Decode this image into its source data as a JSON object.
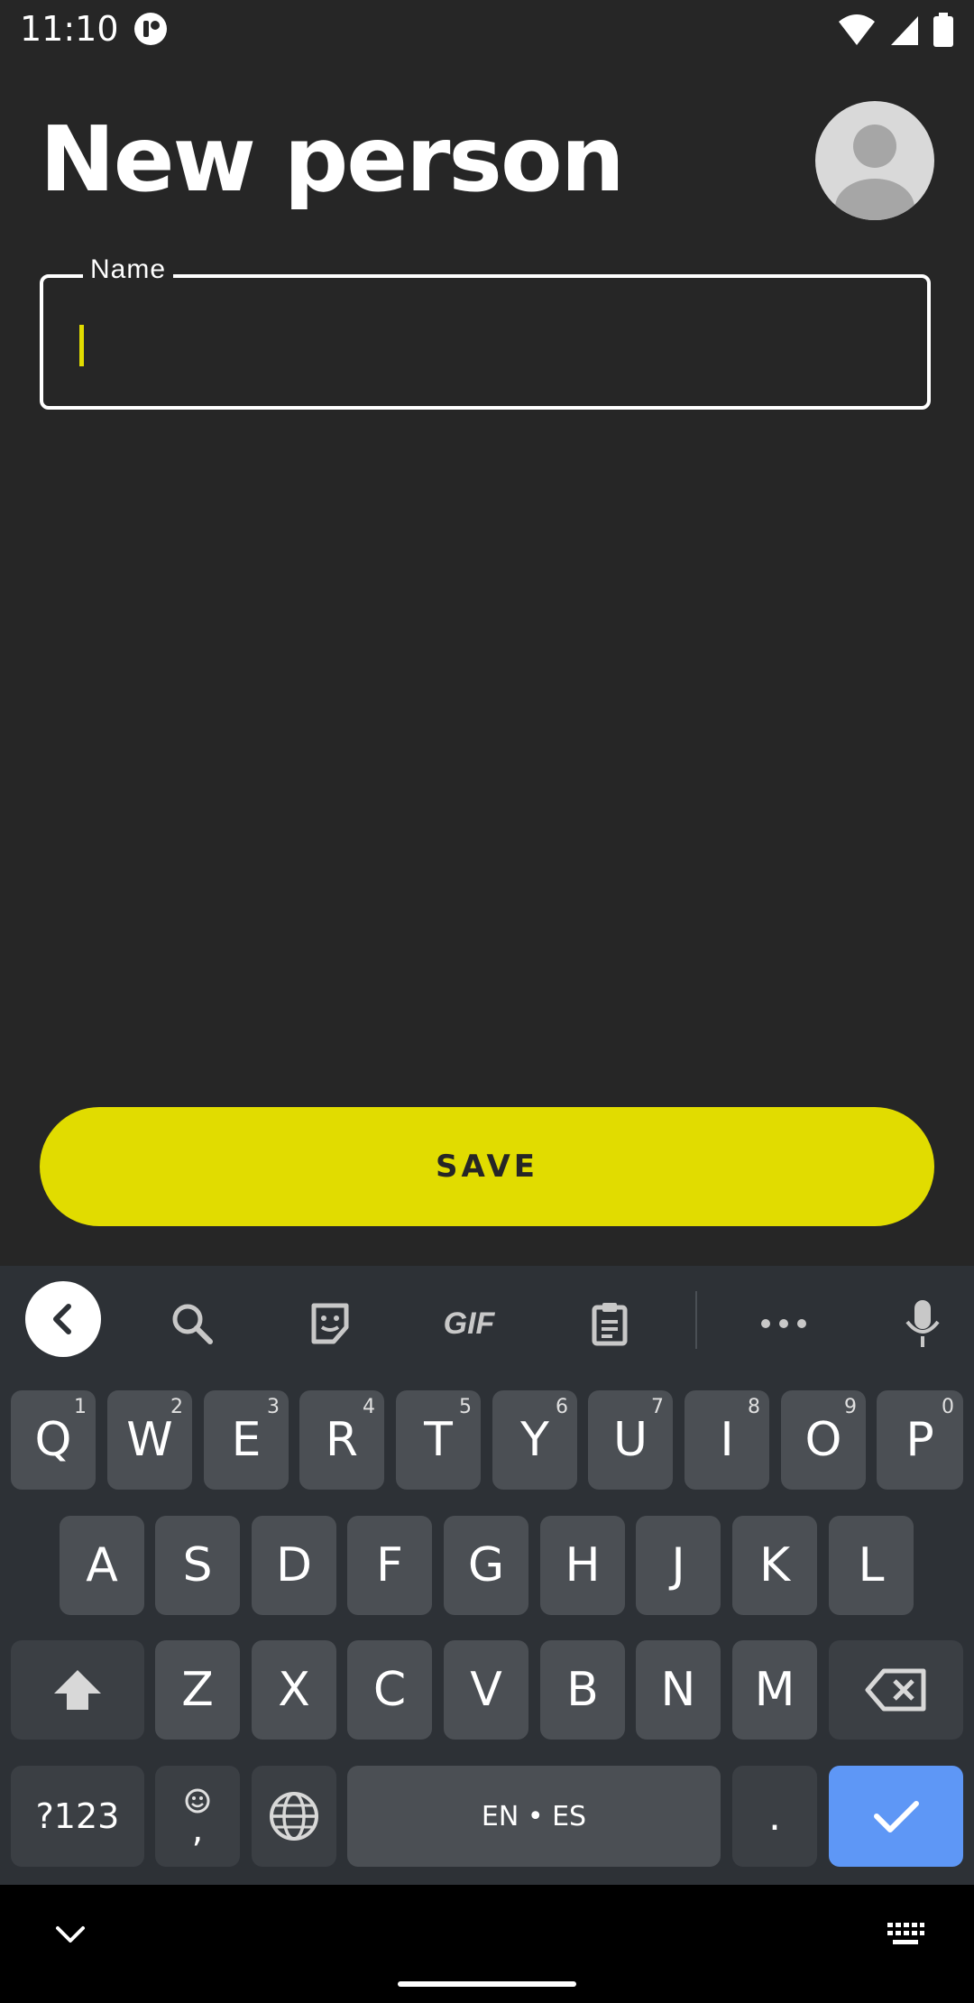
{
  "status_bar": {
    "time": "11:10",
    "icons": [
      "app-notification-icon",
      "wifi-icon",
      "signal-icon",
      "battery-icon"
    ]
  },
  "header": {
    "title": "New person",
    "avatar_icon": "person-avatar-icon"
  },
  "form": {
    "name_label": "Name",
    "name_value": "",
    "save_label": "SAVE"
  },
  "colors": {
    "accent": "#e1dc00",
    "background": "#262626",
    "keyboard_bg": "#2d3136",
    "key_bg": "#4b4f54",
    "enter_key": "#5e97f6"
  },
  "keyboard": {
    "toolbar": [
      "back-icon",
      "search-icon",
      "sticker-icon",
      "GIF",
      "clipboard-icon",
      "more-icon",
      "mic-icon"
    ],
    "row1": [
      {
        "key": "Q",
        "hint": "1"
      },
      {
        "key": "W",
        "hint": "2"
      },
      {
        "key": "E",
        "hint": "3"
      },
      {
        "key": "R",
        "hint": "4"
      },
      {
        "key": "T",
        "hint": "5"
      },
      {
        "key": "Y",
        "hint": "6"
      },
      {
        "key": "U",
        "hint": "7"
      },
      {
        "key": "I",
        "hint": "8"
      },
      {
        "key": "O",
        "hint": "9"
      },
      {
        "key": "P",
        "hint": "0"
      }
    ],
    "row2": [
      "A",
      "S",
      "D",
      "F",
      "G",
      "H",
      "J",
      "K",
      "L"
    ],
    "row3": [
      "Z",
      "X",
      "C",
      "V",
      "B",
      "N",
      "M"
    ],
    "row4": {
      "symbols": "?123",
      "emoji_comma": ",",
      "space": "EN • ES",
      "period": "."
    }
  },
  "navbar": {
    "icons": [
      "hide-keyboard-icon",
      "keyboard-switch-icon"
    ]
  }
}
